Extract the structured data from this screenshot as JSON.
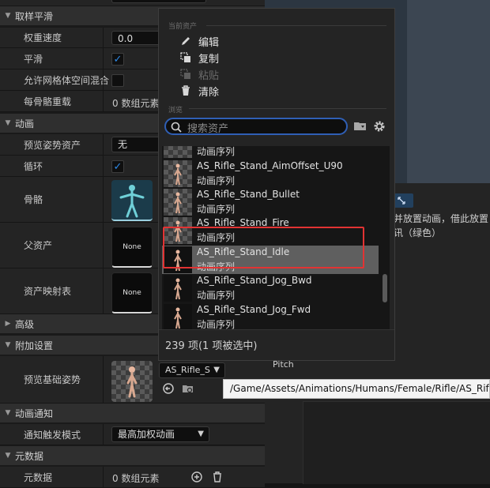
{
  "details": {
    "sections": {
      "sampling": "取样平滑",
      "animation": "动画",
      "advanced": "高级",
      "additive": "附加设置",
      "notifies": "动画通知",
      "metadata": "元数据"
    },
    "rows": {
      "weight_speed": {
        "label": "权重速度",
        "value": "0.0"
      },
      "smooth": {
        "label": "平滑",
        "checked": true
      },
      "allow_mesh_space": {
        "label": "允许网格体空间混合",
        "checked": false
      },
      "per_bone": {
        "label": "每骨骼重载",
        "value": "0 数组元素"
      },
      "preview_pose": {
        "label": "预览姿势资产",
        "value": "无"
      },
      "loop": {
        "label": "循环",
        "checked": true
      },
      "skeleton": {
        "label": "骨骼"
      },
      "parent_asset": {
        "label": "父资产",
        "thumb_text": "None"
      },
      "asset_mapping": {
        "label": "资产映射表",
        "thumb_text": "None"
      },
      "preview_base_pose": {
        "label": "预览基础姿势",
        "value": "AS_Rifle_S"
      },
      "notify_mode": {
        "label": "通知触发模式",
        "value": "最高加权动画"
      },
      "metadata": {
        "label": "元数据",
        "value": "0 数组元素"
      }
    }
  },
  "viewport": {
    "button_label": "",
    "text_line1": "并放置动画，借此放置",
    "text_line2": "讯（绿色）",
    "pitch_label": "Pitch"
  },
  "tooltip": {
    "path": "/Game/Assets/Animations/Humans/Female/Rifle/AS_Rifle_Stand_Idle"
  },
  "picker": {
    "section_current": "当前资产",
    "section_browse": "浏览",
    "menu": {
      "edit": "编辑",
      "copy": "复制",
      "paste": "粘贴",
      "clear": "清除"
    },
    "search_placeholder": "搜索资产",
    "items": [
      {
        "name": "",
        "type": "动画序列"
      },
      {
        "name": "AS_Rifle_Stand_AimOffset_U90",
        "type": "动画序列"
      },
      {
        "name": "AS_Rifle_Stand_Bullet",
        "type": "动画序列"
      },
      {
        "name": "AS_Rifle_Stand_Fire",
        "type": "动画序列"
      },
      {
        "name": "AS_Rifle_Stand_Idle",
        "type": "动画序列"
      },
      {
        "name": "AS_Rifle_Stand_Jog_Bwd",
        "type": "动画序列"
      },
      {
        "name": "AS_Rifle_Stand_Jog_Fwd",
        "type": "动画序列"
      }
    ],
    "footer": "239 项(1 项被选中)"
  },
  "colors": {
    "accent_blue": "#2d8ae8",
    "highlight_red": "#e23333"
  }
}
